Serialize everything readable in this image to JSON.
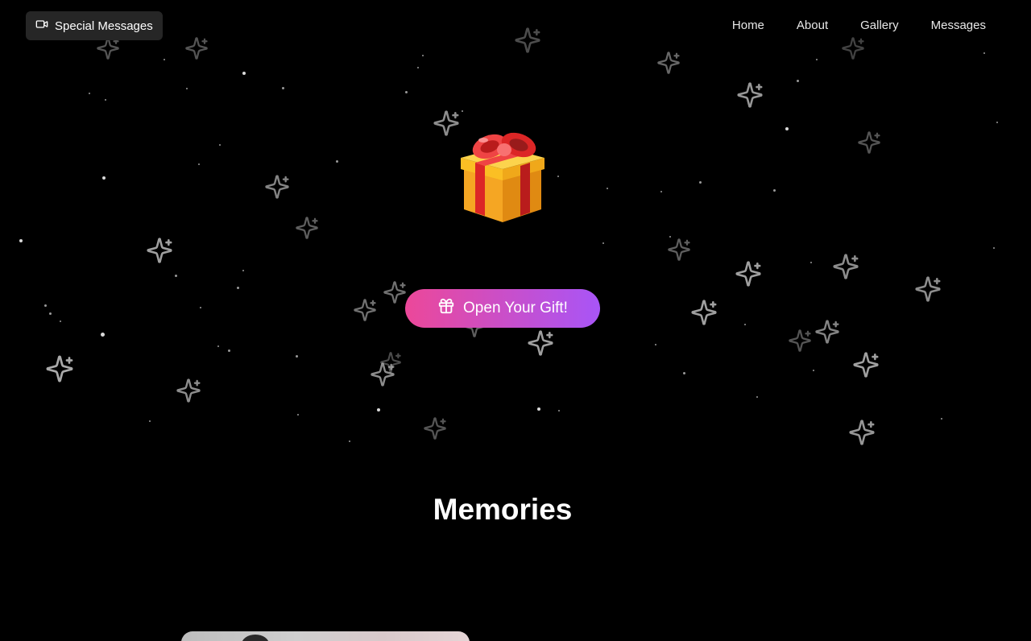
{
  "header": {
    "badge_label": "Special Messages",
    "badge_icon": "video-camera-icon"
  },
  "nav": {
    "items": [
      {
        "label": "Home"
      },
      {
        "label": "About"
      },
      {
        "label": "Gallery"
      },
      {
        "label": "Messages"
      }
    ]
  },
  "hero": {
    "gift_icon": "gift-box-emoji",
    "button_label": "Open Your Gift!",
    "button_icon": "gift-icon",
    "button_gradient": [
      "#ec4899",
      "#a855f7"
    ]
  },
  "memories": {
    "title": "Memories"
  },
  "colors": {
    "background": "#000000",
    "badge_bg": "#262626",
    "sparkle": "#9a9a9a"
  }
}
